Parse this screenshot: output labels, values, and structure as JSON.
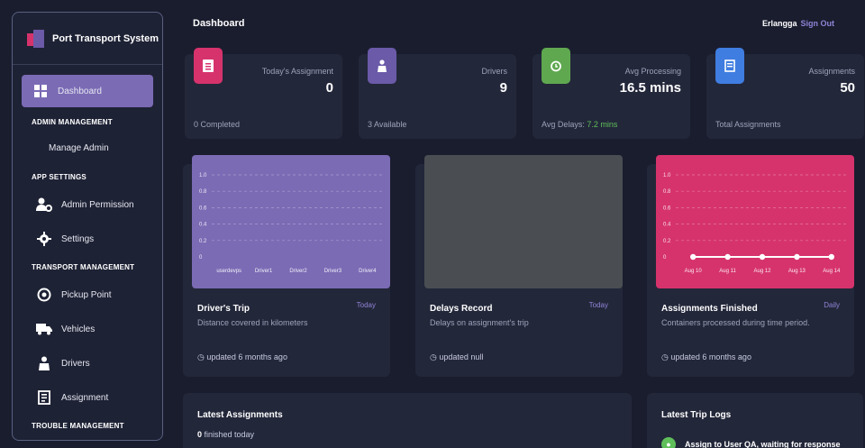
{
  "app": {
    "title": "Port Transport System"
  },
  "sidebar": {
    "dashboard": "Dashboard",
    "admin_management": "ADMIN MANAGEMENT",
    "manage_admin": "Manage Admin",
    "app_settings": "APP SETTINGS",
    "admin_permission": "Admin Permission",
    "settings": "Settings",
    "transport_management": "TRANSPORT MANAGEMENT",
    "pickup_point": "Pickup Point",
    "vehicles": "Vehicles",
    "drivers": "Drivers",
    "assignment": "Assignment",
    "trouble_management": "TROUBLE MANAGEMENT"
  },
  "header": {
    "title": "Dashboard",
    "user": "Erlangga",
    "signout": "Sign Out"
  },
  "stats": [
    {
      "label": "Today's Assignment",
      "value": "0",
      "foot": "0 Completed",
      "color": "#d6336c",
      "icon": "clipboard-icon"
    },
    {
      "label": "Drivers",
      "value": "9",
      "foot": "3 Available",
      "color": "#6a5aa8",
      "icon": "driver-icon"
    },
    {
      "label": "Avg Processing",
      "value": "16.5 mins",
      "foot_prefix": "Avg Delays: ",
      "foot_value": "7.2 mins",
      "color": "#5fa84f",
      "icon": "timer-icon"
    },
    {
      "label": "Assignments",
      "value": "50",
      "foot": "Total Assignments",
      "color": "#3f7de0",
      "icon": "document-icon"
    }
  ],
  "charts": [
    {
      "title": "Driver's Trip",
      "subtitle": "Distance covered in kilometers",
      "tag": "Today",
      "updated": "updated 6 months ago",
      "bg": "#7b6bb5"
    },
    {
      "title": "Delays Record",
      "subtitle": "Delays on assignment's trip",
      "tag": "Today",
      "updated": "updated null",
      "bg": "#4a4e52"
    },
    {
      "title": "Assignments Finished",
      "subtitle": "Containers processed during time period.",
      "tag": "Daily",
      "updated": "updated 6 months ago",
      "bg": "#d6336c"
    }
  ],
  "chart_data": [
    {
      "type": "bar",
      "categories": [
        "userdevps",
        "Driver1",
        "Driver2",
        "Driver3",
        "Driver4"
      ],
      "values": [
        0,
        0,
        0,
        0,
        0
      ],
      "yticks": [
        "1.0",
        "0.8",
        "0.6",
        "0.4",
        "0.2",
        "0"
      ],
      "ylim": [
        0,
        1
      ]
    },
    {
      "type": "line",
      "x": [
        "Aug 10",
        "Aug 11",
        "Aug 12",
        "Aug 13",
        "Aug 14"
      ],
      "y": [
        0,
        0,
        0,
        0,
        0
      ],
      "yticks": [
        "1.0",
        "0.8",
        "0.6",
        "0.4",
        "0.2",
        "0"
      ],
      "ylim": [
        0,
        1
      ]
    }
  ],
  "bottom": {
    "latest_title": "Latest Assignments",
    "latest_count": "0",
    "latest_suffix": " finished today",
    "logs_title": "Latest Trip Logs",
    "log_text": "Assign to User QA, waiting for response"
  }
}
